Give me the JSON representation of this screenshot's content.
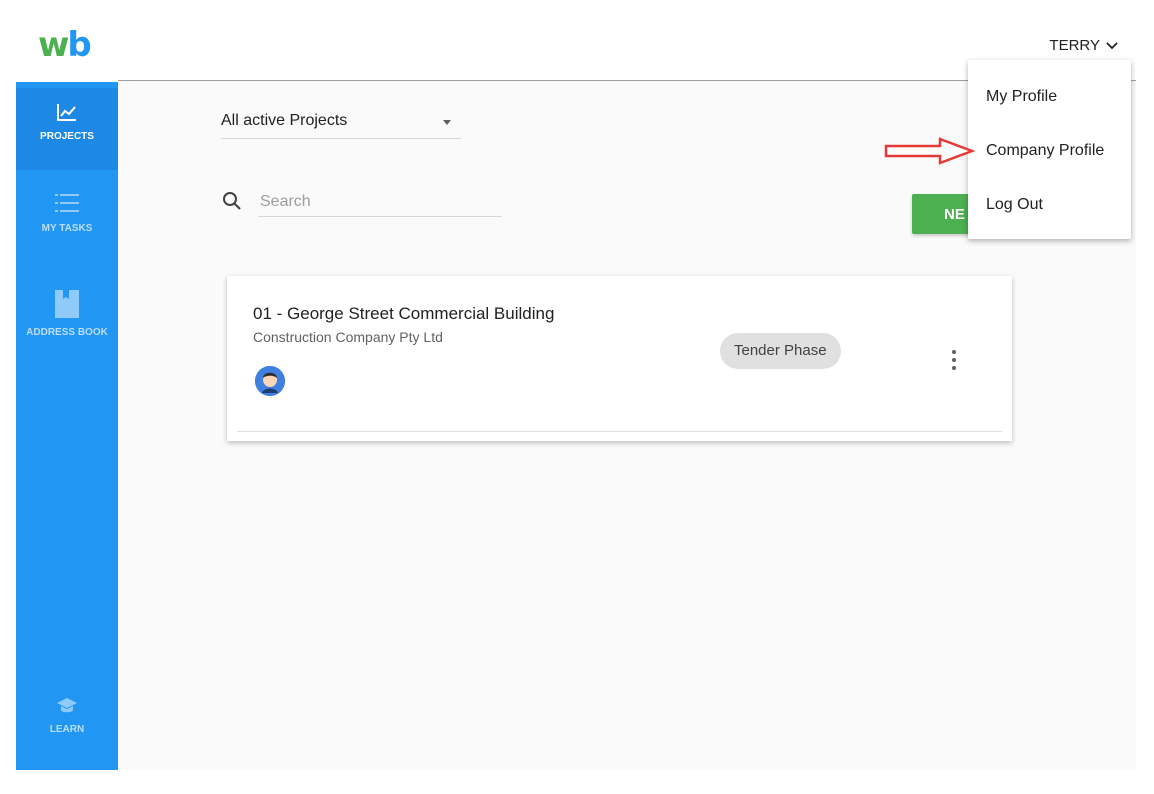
{
  "header": {
    "logo_w": "w",
    "logo_b": "b",
    "user_name": "TERRY"
  },
  "sidebar": {
    "items": [
      {
        "label": "PROJECTS",
        "icon": "chart-line-icon",
        "active": true
      },
      {
        "label": "MY TASKS",
        "icon": "list-icon",
        "active": false
      },
      {
        "label": "ADDRESS BOOK",
        "icon": "book-icon",
        "active": false
      },
      {
        "label": "LEARN",
        "icon": "graduation-cap-icon",
        "active": false
      }
    ]
  },
  "main": {
    "filter_value": "All active Projects",
    "search": {
      "placeholder": "Search",
      "value": ""
    },
    "new_button_label": "NE",
    "project_card": {
      "title": "01 - George Street Commercial Building",
      "company": "Construction Company Pty Ltd",
      "phase": "Tender Phase"
    }
  },
  "user_dropdown": {
    "items": [
      "My Profile",
      "Company Profile",
      "Log Out"
    ]
  },
  "colors": {
    "primary": "#2196f3",
    "accent_green": "#4caf50",
    "annotation_arrow": "#e53935"
  }
}
